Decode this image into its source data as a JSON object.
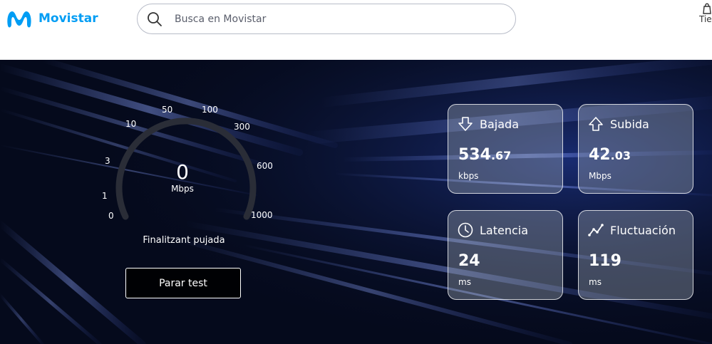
{
  "brand": {
    "name": "Movistar",
    "color": "#019df4"
  },
  "search": {
    "placeholder": "Busca en Movistar",
    "value": ""
  },
  "header_right": {
    "label": "Tie",
    "icon": "shopping-bag-icon"
  },
  "gauge": {
    "scale_labels": [
      "0",
      "1",
      "3",
      "10",
      "50",
      "100",
      "300",
      "600",
      "1000"
    ],
    "value": "0",
    "unit": "Mbps"
  },
  "status_text": "Finalitzant pujada",
  "stop_button_label": "Parar test",
  "cards": {
    "download": {
      "icon": "arrow-down-icon",
      "title": "Bajada",
      "value_int": "534",
      "value_dec": ".67",
      "unit": "kbps"
    },
    "upload": {
      "icon": "arrow-up-icon",
      "title": "Subida",
      "value_int": "42",
      "value_dec": ".03",
      "unit": "Mbps"
    },
    "latency": {
      "icon": "clock-icon",
      "title": "Latencia",
      "value_int": "24",
      "value_dec": "",
      "unit": "ms"
    },
    "jitter": {
      "icon": "trend-line-icon",
      "title": "Fluctuación",
      "value_int": "119",
      "value_dec": "",
      "unit": "ms"
    }
  },
  "colors": {
    "background": "#050a1c",
    "streak": "#4a6cf0",
    "text": "#ffffff"
  }
}
